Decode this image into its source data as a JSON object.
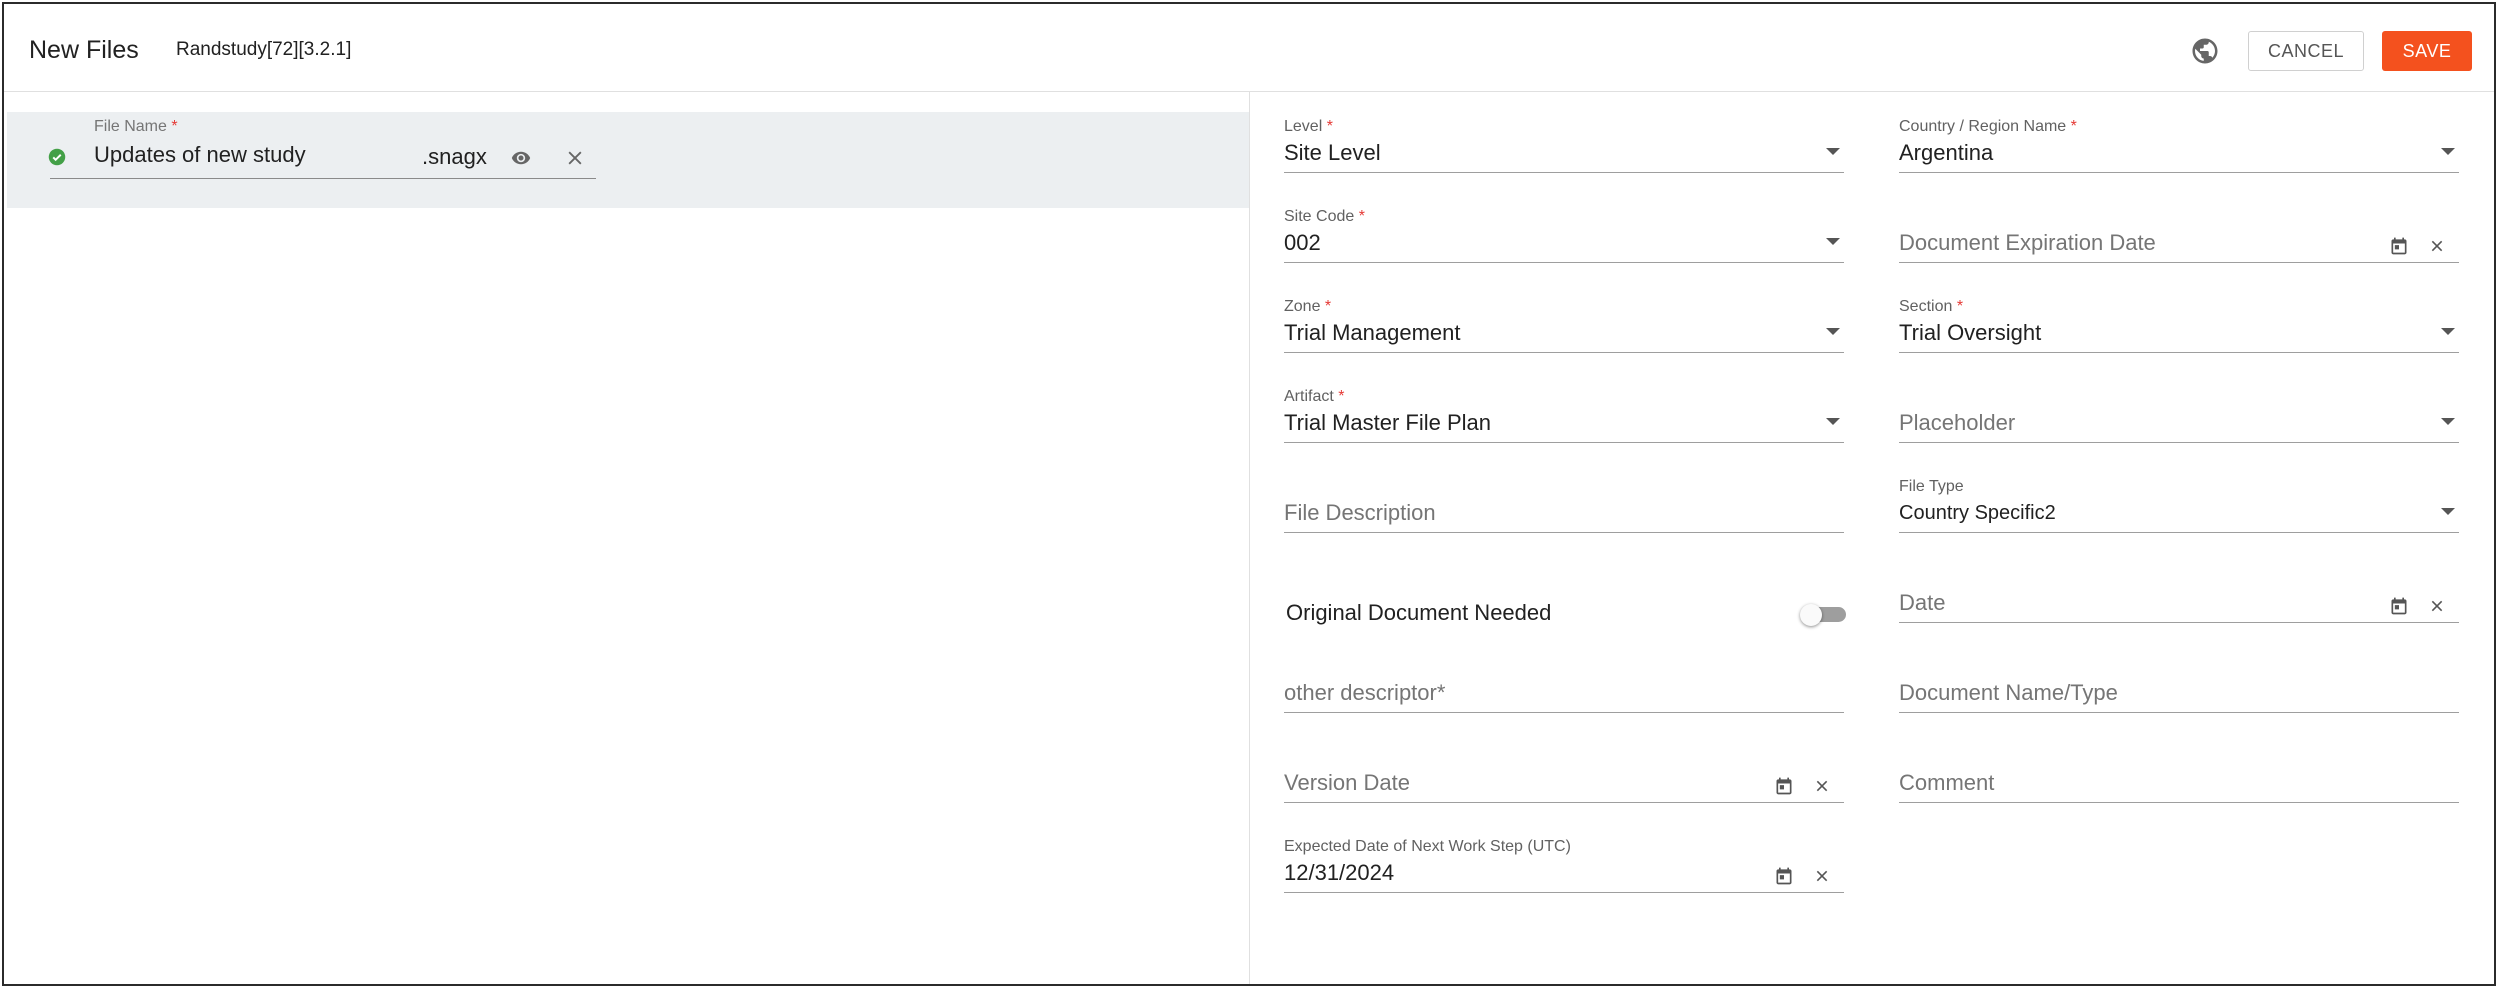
{
  "header": {
    "title": "New Files",
    "study": "Randstudy[72][3.2.1]",
    "cancel_label": "CANCEL",
    "save_label": "SAVE",
    "globe_icon": "globe-icon"
  },
  "file": {
    "label": "File Name",
    "required_mark": "*",
    "name": "Updates of new study",
    "extension": ".snagx",
    "status_icon": "check-circle-icon"
  },
  "form": {
    "level": {
      "label": "Level",
      "value": "Site Level"
    },
    "country": {
      "label": "Country / Region Name",
      "value": "Argentina"
    },
    "site_code": {
      "label": "Site Code",
      "value": "002"
    },
    "doc_expiration": {
      "placeholder": "Document Expiration Date"
    },
    "zone": {
      "label": "Zone",
      "value": "Trial Management"
    },
    "section": {
      "label": "Section",
      "value": "Trial Oversight"
    },
    "artifact": {
      "label": "Artifact",
      "value": "Trial Master File Plan"
    },
    "placeholder": {
      "placeholder": "Placeholder"
    },
    "file_description": {
      "placeholder": "File Description"
    },
    "file_type": {
      "label": "File Type",
      "value": "Country Specific2"
    },
    "original_needed": {
      "label": "Original Document Needed",
      "on": false
    },
    "date": {
      "placeholder": "Date"
    },
    "other_descriptor": {
      "placeholder": "other descriptor*"
    },
    "doc_name_type": {
      "placeholder": "Document Name/Type"
    },
    "version_date": {
      "placeholder": "Version Date"
    },
    "comment": {
      "placeholder": "Comment"
    },
    "next_work_step": {
      "label": "Expected Date of Next Work Step (UTC)",
      "value": "12/31/2024"
    }
  },
  "colors": {
    "accent": "#f4511e",
    "success": "#43a047",
    "required": "#e53935"
  }
}
